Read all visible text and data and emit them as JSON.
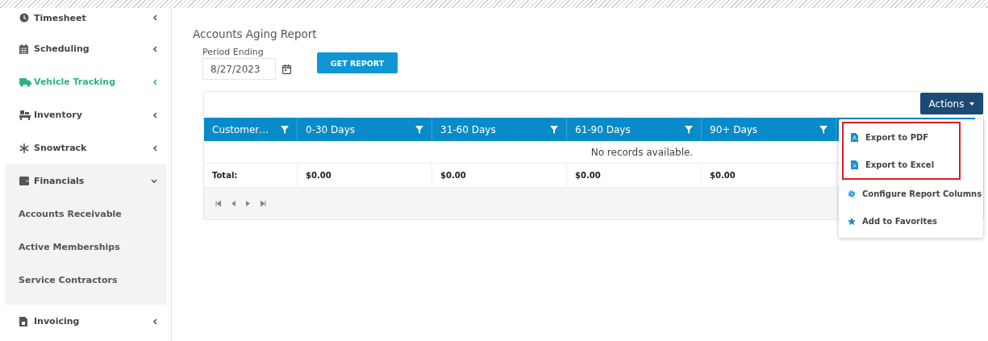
{
  "sidebar": {
    "items": [
      {
        "label": "Timesheet",
        "selected": false,
        "expanded": false
      },
      {
        "label": "Scheduling",
        "selected": false,
        "expanded": false
      },
      {
        "label": "Vehicle Tracking",
        "selected": true,
        "expanded": false
      },
      {
        "label": "Inventory",
        "selected": false,
        "expanded": false
      },
      {
        "label": "Snowtrack",
        "selected": false,
        "expanded": false
      },
      {
        "label": "Financials",
        "selected": false,
        "expanded": true,
        "children": [
          {
            "label": "Accounts Receivable"
          },
          {
            "label": "Active Memberships"
          },
          {
            "label": "Service Contractors"
          }
        ]
      },
      {
        "label": "Invoicing",
        "selected": false,
        "expanded": false
      }
    ]
  },
  "report": {
    "title": "Accounts Aging Report",
    "period_label": "Period Ending",
    "period_value": "8/27/2023",
    "get_report_button": "GET REPORT",
    "grid": {
      "columns": [
        {
          "label": "Customer…"
        },
        {
          "label": "0-30 Days"
        },
        {
          "label": "31-60 Days"
        },
        {
          "label": "61-90 Days"
        },
        {
          "label": "90+ Days"
        }
      ],
      "empty_message": "No records available.",
      "totals": [
        "Total:",
        "$0.00",
        "$0.00",
        "$0.00",
        "$0.00"
      ]
    },
    "actions": {
      "label": "Actions",
      "menu": [
        {
          "label": "Export to PDF",
          "highlighted": true
        },
        {
          "label": "Export to Excel",
          "highlighted": true
        },
        {
          "label": "Configure Report Columns",
          "highlighted": false
        },
        {
          "label": "Add to Favorites",
          "highlighted": false
        }
      ]
    }
  }
}
